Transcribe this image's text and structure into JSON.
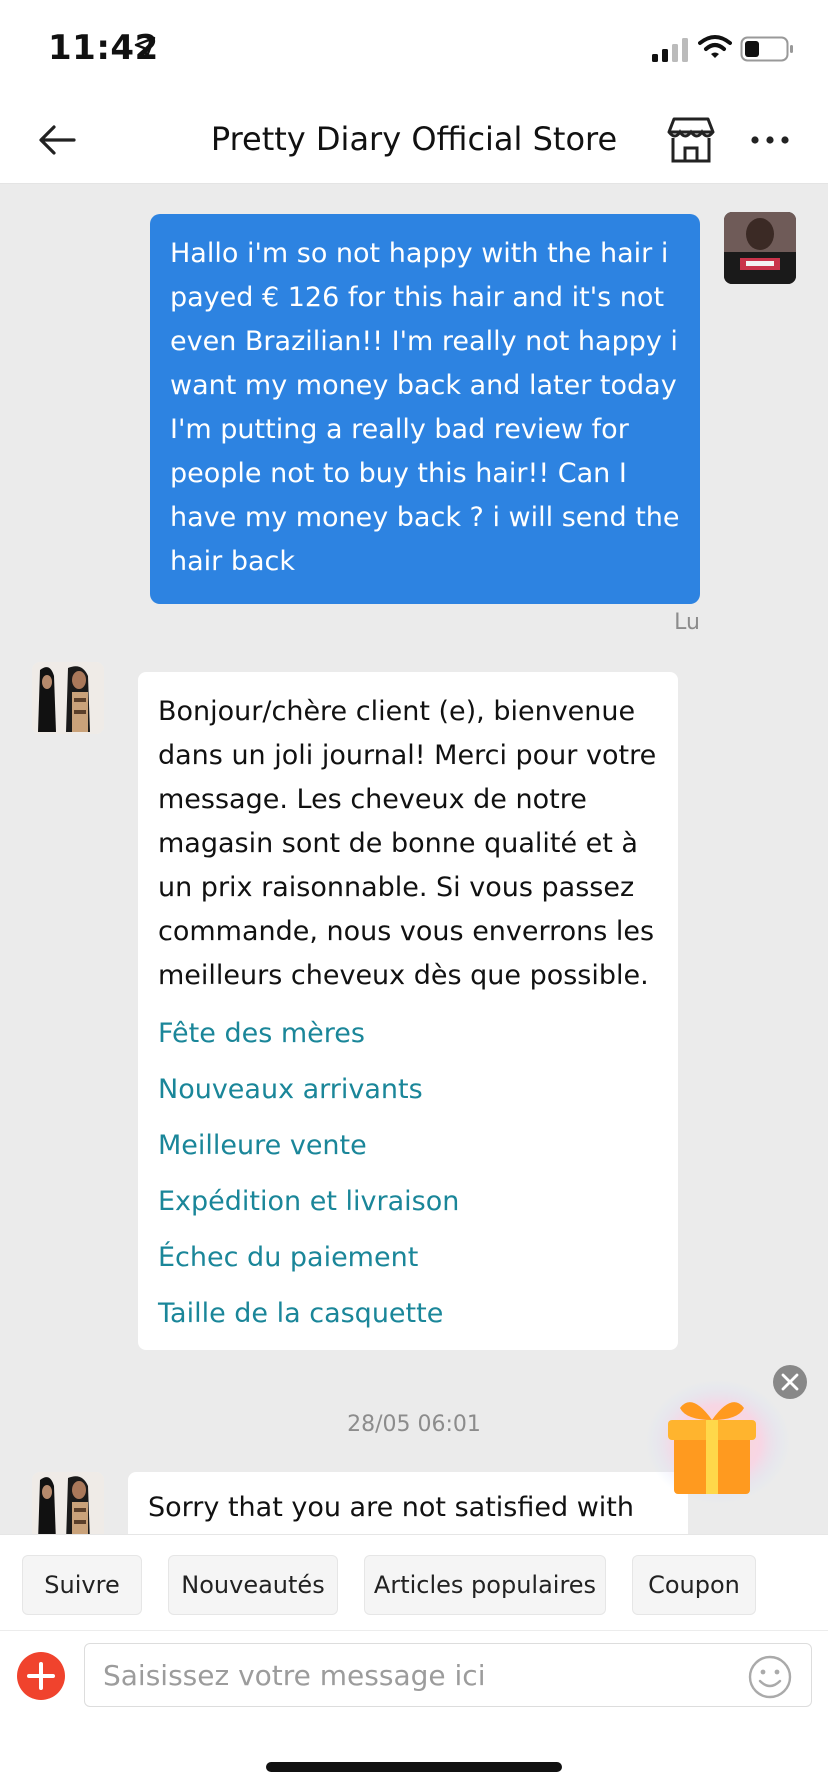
{
  "status_bar": {
    "time": "11:42",
    "icons": [
      "location-arrow-icon",
      "cellular-signal-icon",
      "wifi-icon",
      "battery-icon"
    ]
  },
  "header": {
    "title": "Pretty Diary Official Store",
    "icons": [
      "back-arrow-icon",
      "store-icon",
      "more-icon"
    ]
  },
  "messages": {
    "outgoing": {
      "text": "Hallo i'm so not happy with the hair i payed € 126 for this hair and it's not even Brazilian!! I'm really not happy i want my money back and later today I'm putting a really bad review for people not to buy this hair!! Can I have my money back ? i will send the hair back",
      "status": "Lu"
    },
    "store_reply": {
      "text": "Bonjour/chère client (e), bienvenue dans un joli journal! Merci pour votre message. Les cheveux de notre magasin sont de bonne qualité et à un prix raisonnable. Si vous passez commande, nous vous enverrons les meilleurs cheveux dès que possible.",
      "links": [
        "Fête des mères",
        "Nouveaux arrivants",
        "Meilleure vente",
        "Expédition et livraison",
        "Échec du paiement",
        "Taille de la casquette"
      ]
    },
    "timestamp": "28/05 06:01",
    "store_reply_2": {
      "text": "Sorry that you are not satisfied with our"
    }
  },
  "quick_replies": [
    "Suivre",
    "Nouveautés",
    "Articles populaires",
    "Coupon"
  ],
  "input": {
    "placeholder": "Saisissez votre message ici"
  },
  "colors": {
    "outgoing_bubble": "#2d83e1",
    "link": "#1a8699",
    "plus_button": "#f0432d",
    "background": "#ebebeb"
  }
}
